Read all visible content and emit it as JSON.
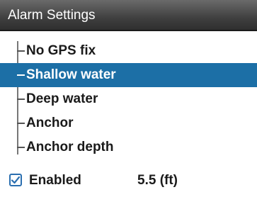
{
  "header": {
    "title": "Alarm Settings"
  },
  "list": {
    "items": [
      {
        "label": "No GPS fix",
        "selected": false
      },
      {
        "label": "Shallow water",
        "selected": true
      },
      {
        "label": "Deep water",
        "selected": false
      },
      {
        "label": "Anchor",
        "selected": false
      },
      {
        "label": "Anchor depth",
        "selected": false
      }
    ]
  },
  "footer": {
    "enabled_label": "Enabled",
    "enabled_checked": true,
    "value": "5.5 (ft)"
  },
  "colors": {
    "selection": "#1c6fa6",
    "title_bg": "#3e3e3e",
    "checkbox_border": "#2b6fb0"
  }
}
